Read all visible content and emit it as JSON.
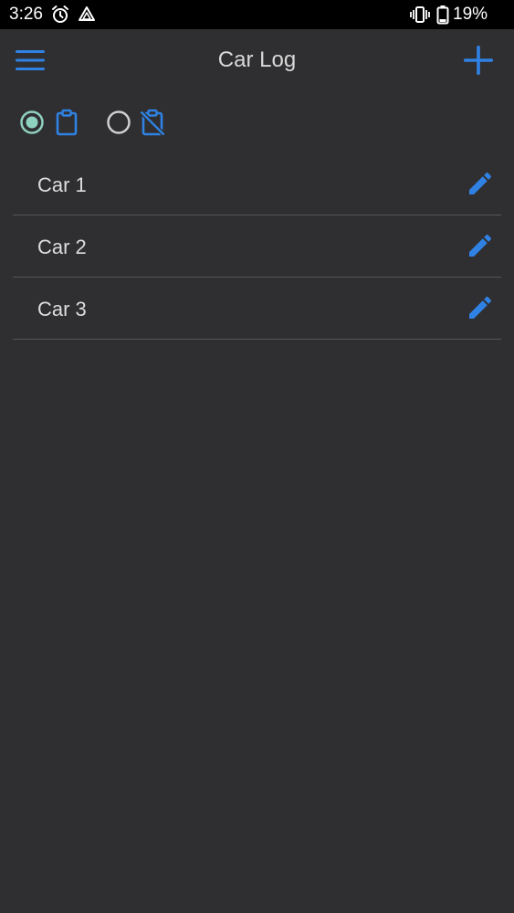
{
  "status_bar": {
    "time": "3:26",
    "icons": [
      "alarm-icon",
      "drive-icon",
      "vibrate-icon",
      "battery-icon"
    ],
    "battery_percent": "19%"
  },
  "app_bar": {
    "title": "Car Log",
    "menu_icon": "hamburger-menu-icon",
    "add_icon": "plus-icon"
  },
  "filter": {
    "options": [
      {
        "icon": "clipboard-icon",
        "selected": true
      },
      {
        "icon": "clipboard-off-icon",
        "selected": false
      }
    ]
  },
  "cars": [
    {
      "name": "Car 1",
      "action_icon": "pencil-edit-icon"
    },
    {
      "name": "Car 2",
      "action_icon": "pencil-edit-icon"
    },
    {
      "name": "Car 3",
      "action_icon": "pencil-edit-icon"
    }
  ],
  "colors": {
    "background": "#2f2e30",
    "accent_blue": "#2f82e3",
    "radio_selected": "#8fd1bf",
    "radio_unselected": "#cfcfcf",
    "divider": "#555458",
    "text": "#dddddd"
  }
}
